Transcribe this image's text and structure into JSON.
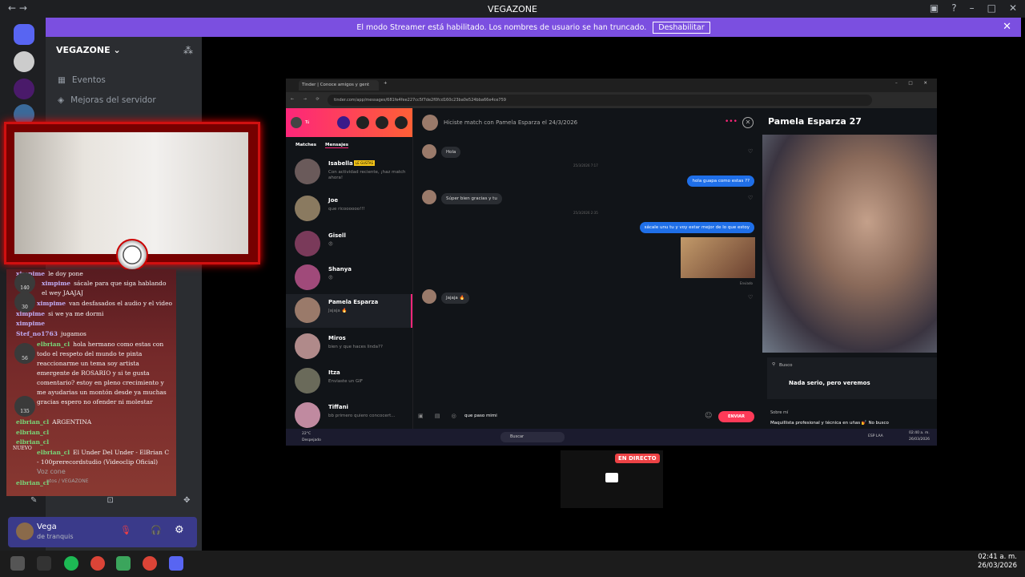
{
  "titlebar": {
    "title": "VEGAZONE"
  },
  "streamer_bar": {
    "text": "El modo Streamer está habilitado. Los nombres de usuario se han truncado.",
    "button": "Deshabilitar"
  },
  "server": {
    "name": "VEGAZONE",
    "channels": [
      {
        "label": "Eventos"
      },
      {
        "label": "Mejoras del servidor"
      }
    ]
  },
  "chat": {
    "lines": [
      {
        "user": "ximpime",
        "text": "le doy pone"
      },
      {
        "user": "ximpime",
        "text": "sácale para que siga hablando el wey JAAJAJ"
      },
      {
        "user": "ximpime",
        "text": "van desfasados el audio y el video"
      },
      {
        "user": "ximpime",
        "text": "si we ya me dormi"
      },
      {
        "user": "ximpime",
        "text": ""
      },
      {
        "user": "Stef_no1763",
        "text": "jugamos"
      },
      {
        "user": "elbrian_cl",
        "text": "hola hermano como estas con todo el respeto del mundo te pinta reaccionarme un tema soy artista emergente de ROSARIO y si te gusta comentario? estoy en pleno crecimiento y me ayudarias un montón desde ya muchas gracias espero no ofender ni molestar"
      },
      {
        "user": "elbrian_cl",
        "text": "ARGENTINA"
      },
      {
        "user": "elbrian_cl",
        "text": ""
      },
      {
        "user": "elbrian_cl",
        "text": ""
      },
      {
        "user": "elbrian_cl",
        "text": "El Under Del Under - ElBrian C - 100prerecordstudio (Videoclip Oficial)"
      },
      {
        "user": "elbrian_cl",
        "text": ""
      }
    ],
    "badges": [
      "140",
      "30",
      "56",
      "135",
      "NUEVO"
    ],
    "voice_label": "Voz cone",
    "voice_sub": "ntos / VEGAZONE"
  },
  "user": {
    "name": "Vega",
    "status": "de tranquis"
  },
  "clock": {
    "time": "02:41 a. m.",
    "date": "26/03/2026"
  },
  "browser": {
    "tab_title": "Tinder | Conoce amigos y gent",
    "url": "tinder.com/app/messages/681fe4fee227cc5f7de2f0fcd160c23ba0e524bba66e4ce759"
  },
  "tinder": {
    "me": "Tú",
    "tabs": [
      "Matches",
      "Mensajes"
    ],
    "matches": [
      {
        "name": "Isabella",
        "badge": "LE GUSTAS",
        "msg": "Con actividad reciente, ¡haz match ahora!"
      },
      {
        "name": "Joe",
        "msg": "que ricoooooo!!!"
      },
      {
        "name": "Gisell",
        "msg": "😡"
      },
      {
        "name": "Shanya",
        "msg": "😡"
      },
      {
        "name": "Pamela Esparza",
        "msg": "Jajaja 🔥"
      },
      {
        "name": "Miros",
        "msg": "bien y que haces linda??"
      },
      {
        "name": "Itza",
        "msg": "Enviaste un GIF"
      },
      {
        "name": "Tiffani",
        "msg": "bb primero quiero concocert..."
      }
    ],
    "chat_header": "Hiciste match con Pamela Esparza el 24/3/2026",
    "messages": [
      {
        "dir": "in",
        "text": "Hola"
      },
      {
        "dir": "date",
        "text": "25/3/2026 7:17"
      },
      {
        "dir": "out",
        "text": "hola guapa como estas ??"
      },
      {
        "dir": "in",
        "text": "Súper bien gracias y tu"
      },
      {
        "dir": "date",
        "text": "25/3/2026 2:35"
      },
      {
        "dir": "out",
        "text": "sácale unu tu y voy estar mejor de lo que estoy"
      },
      {
        "dir": "in",
        "text": "Jajaja 🔥"
      }
    ],
    "sent_label": "Enviado",
    "input_text": "que paso mimi",
    "send_label": "ENVIAR",
    "profile": {
      "name": "Pamela Esparza",
      "age": "27",
      "looking_for_label": "Busco",
      "looking_for": "Nada serio, pero veremos",
      "about_label": "Sobre mí",
      "about": "Maquillista profesional y técnica en uñas 💅 No busco"
    },
    "inner_taskbar": {
      "weather": "22°C",
      "weather_sub": "Despejado",
      "search": "Buscar",
      "lang": "ESP LAA",
      "time": "02:40 a. m.",
      "date": "26/03/2026"
    }
  },
  "live": {
    "label": "EN DIRECTO"
  }
}
